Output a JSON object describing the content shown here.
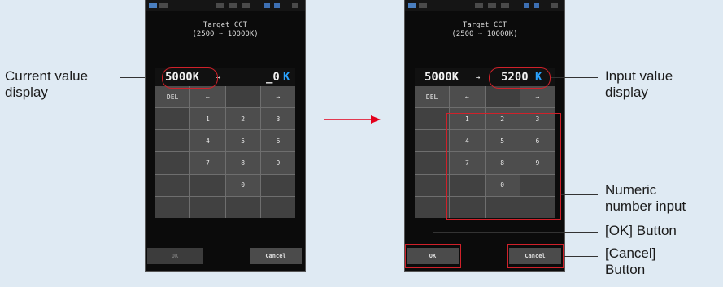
{
  "labels": {
    "current_value": "Current value\ndisplay",
    "input_value": "Input value\ndisplay",
    "numeric_input": "Numeric\nnumber input",
    "ok_button": "[OK] Button",
    "cancel_button": "[Cancel]\nButton"
  },
  "screen": {
    "title_line1": "Target CCT",
    "title_line2": "(2500 ~ 10000K)",
    "arrow": "→"
  },
  "before": {
    "current": "5000K",
    "input": "_0",
    "unit": "K",
    "ok_label": "OK",
    "cancel_label": "Cancel"
  },
  "after": {
    "current": "5000K",
    "input": "5200",
    "unit": "K",
    "ok_label": "OK",
    "cancel_label": "Cancel"
  },
  "keypad": {
    "del": "DEL",
    "left": "←",
    "right": "→",
    "k1": "1",
    "k2": "2",
    "k3": "3",
    "k4": "4",
    "k5": "5",
    "k6": "6",
    "k7": "7",
    "k8": "8",
    "k9": "9",
    "k0": "0"
  },
  "colors": {
    "callout": "#d0212a",
    "unit_blue": "#2aa3ff",
    "page_bg": "#dfeaf3",
    "transition_arrow": "#e3001b"
  }
}
